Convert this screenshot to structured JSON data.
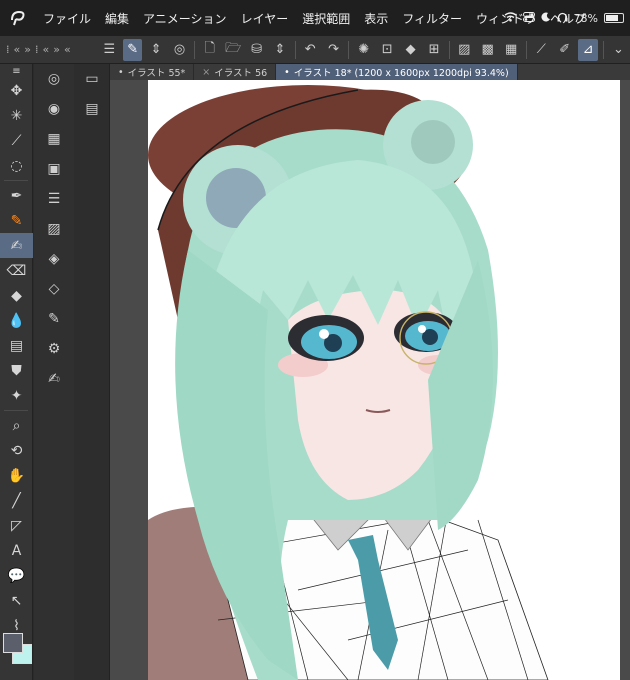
{
  "menubar": {
    "app_icon": "clip-studio-logo-icon",
    "items": [
      "ファイル",
      "編集",
      "アニメーション",
      "レイヤー",
      "選択範囲",
      "表示",
      "フィルター",
      "ウィンドウ",
      "ヘルプ"
    ],
    "status": {
      "battery_percent": "78%",
      "battery_level": 0.78
    }
  },
  "tabs": [
    {
      "label": "イラスト 55*",
      "active": false
    },
    {
      "label": "イラスト 56",
      "active": false
    },
    {
      "label": "イラスト 18* (1200 x 1600px 1200dpi 93.4%)",
      "active": true
    }
  ],
  "colors": {
    "main": "#5b5f6c",
    "sub": "#bdf2ef",
    "accent": "#5a6b86",
    "active_tool": "#ff8a1f"
  }
}
